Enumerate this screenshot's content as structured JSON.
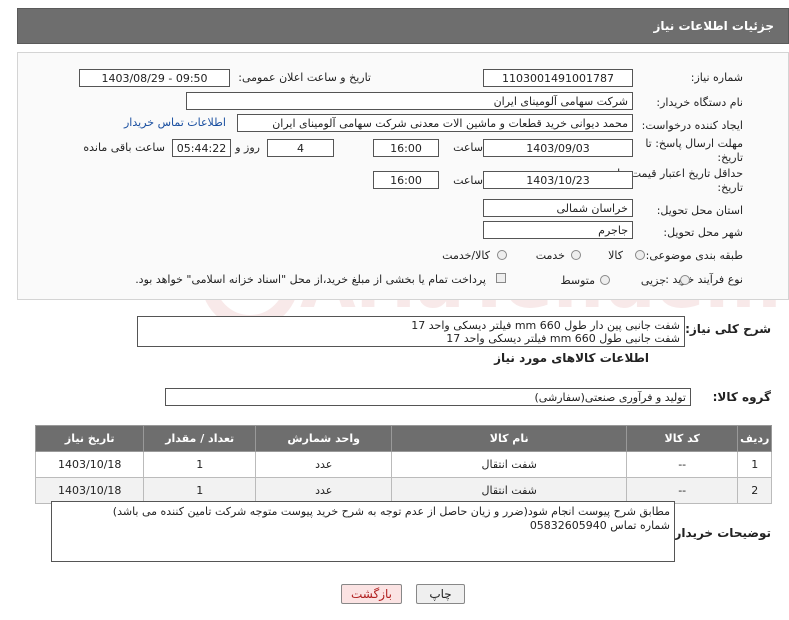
{
  "header": {
    "title": "جزئیات اطلاعات نیاز"
  },
  "form": {
    "need_number_label": "شماره نیاز:",
    "need_number": "1103001491001787",
    "announce_label": "تاریخ و ساعت اعلان عمومی:",
    "announce_value": "1403/08/29 - 09:50",
    "buyer_org_label": "نام دستگاه خریدار:",
    "buyer_org": "شرکت سهامی آلومینای ایران",
    "creator_label": "ایجاد کننده درخواست:",
    "creator": "محمد دیوانی خرید قطعات و ماشین الات معدنی شرکت سهامی آلومینای ایران",
    "contact_link": "اطلاعات تماس خریدار",
    "deadline_label_1": "مهلت ارسال پاسخ: تا",
    "deadline_label_2": "تاریخ:",
    "deadline_date": "1403/09/03",
    "time_label": "ساعت",
    "deadline_time": "16:00",
    "days_value": "4",
    "days_label": "روز و",
    "remaining_time": "05:44:22",
    "remaining_label": "ساعت باقی مانده",
    "validity_label_1": "حداقل تاریخ اعتبار قیمت: تا",
    "validity_label_2": "تاریخ:",
    "validity_date": "1403/10/23",
    "validity_time_label": "ساعت",
    "validity_time": "16:00",
    "province_label": "استان محل تحویل:",
    "province": "خراسان شمالی",
    "city_label": "شهر محل تحویل:",
    "city": "جاجرم",
    "category_label": "طبقه بندی موضوعی:",
    "category_options": [
      "کالا",
      "خدمت",
      "کالا/خدمت"
    ],
    "purchase_type_label": "نوع فرآیند خرید :",
    "purchase_type_options": [
      "جزیی",
      "متوسط"
    ],
    "payment_note": "پرداخت تمام یا بخشی از مبلغ خرید،از محل \"اسناد خزانه اسلامی\" خواهد بود."
  },
  "description": {
    "label": "شرح کلی نیاز:",
    "line1": "شفت جانبی پین دار طول 660 mm  فیلتر دیسکی واحد 17",
    "line2": "شفت جانبی طول 660 mm  فیلتر دیسکی واحد 17"
  },
  "goods_info_title": "اطلاعات کالاهای مورد نیاز",
  "goods_group": {
    "label": "گروه کالا:",
    "value": "تولید و فرآوری صنعتی(سفارشی)"
  },
  "table": {
    "headers": [
      "ردیف",
      "کد کالا",
      "نام کالا",
      "واحد شمارش",
      "تعداد / مقدار",
      "تاریخ نیاز"
    ],
    "rows": [
      [
        "1",
        "--",
        "شفت انتقال",
        "عدد",
        "1",
        "1403/10/18"
      ],
      [
        "2",
        "--",
        "شفت انتقال",
        "عدد",
        "1",
        "1403/10/18"
      ]
    ]
  },
  "buyer_notes": {
    "label": "توضیحات خریدار:",
    "line1": "مطابق شرح پیوست انجام شود(ضرر و زیان حاصل از عدم توجه به شرح خرید پیوست متوجه شرکت تامین کننده می باشد)",
    "line2": "شماره تماس 05832605940"
  },
  "buttons": {
    "print": "چاپ",
    "back": "بازگشت"
  },
  "watermark": "AriaTender.net",
  "colors": {
    "header_bg": "#6e6e6e",
    "link": "#1a4fa0",
    "back_button_bg": "#fbe3e3",
    "back_button_text": "#b02020"
  }
}
